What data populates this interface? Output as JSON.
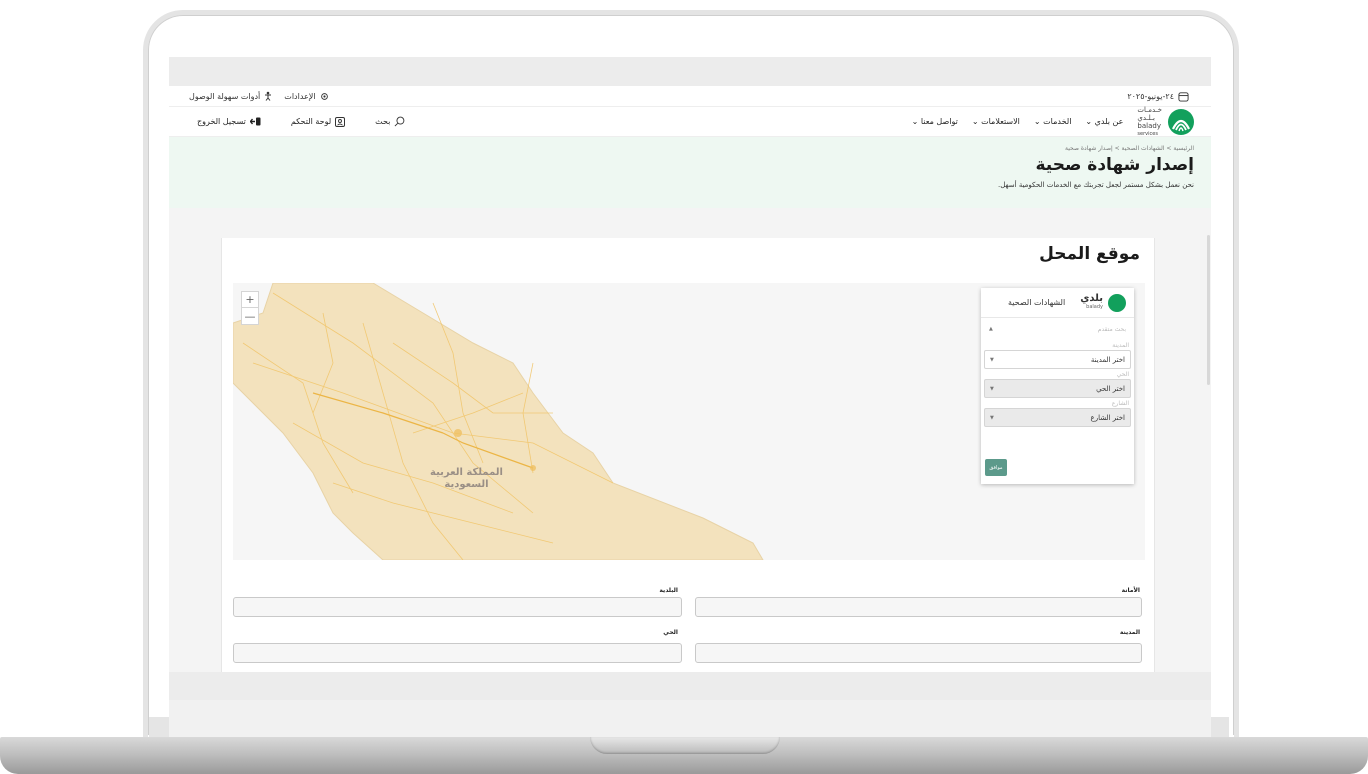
{
  "utility": {
    "date": "٢٤-يونيو-٢٠٢٥",
    "accessibility": "أدوات سهولة الوصول",
    "settings": "الإعدادات"
  },
  "logo": {
    "line1": "ﺧـﺪﻣـﺎت",
    "line2": "بـلـدي",
    "line3": "balady",
    "line4": "services"
  },
  "nav": {
    "items": [
      "عن بلدي ⌄",
      "الخدمات ⌄",
      "الاستعلامات ⌄",
      "تواصل معنا ⌄"
    ],
    "search": "بحث",
    "dashboard": "لوحة التحكم",
    "logout": "تسجيل الخروج"
  },
  "hero": {
    "breadcrumb": "الرئيسية  >  الشهادات الصحية  >  إصدار شهادة صحية",
    "title": "إصدار شهادة صحية",
    "subtitle": "نحن نعمل بشكل مستمر لجعل تجربتك مع الخدمات الحكومية أسهل."
  },
  "section": {
    "title": "موقع المحل"
  },
  "map": {
    "label_line1": "المملكة العربية",
    "label_line2": "السعودية",
    "zoom_in": "+",
    "zoom_out": "—",
    "land_color": "#f3e2bd",
    "road_color": "#f1c66c"
  },
  "panel": {
    "brand": "بلدي",
    "brand_sub": "balady",
    "title": "الشهادات الصحية",
    "advanced_search": "بحث متقدم",
    "city_label": "المدينة",
    "city_value": "اختر المدينة",
    "district_label": "الحي",
    "district_value": "اختر الحي",
    "street_label": "الشارع",
    "street_value": "اختر الشارع",
    "ok": "موافق"
  },
  "form": {
    "amanah_label": "الأمانة",
    "baladiya_label": "البلدية",
    "city_label": "المدينة",
    "district_label": "الحي"
  },
  "colors": {
    "brand_green": "#12a05c",
    "button": "#5c9a8b",
    "hero_bg": "#eef8f2"
  }
}
